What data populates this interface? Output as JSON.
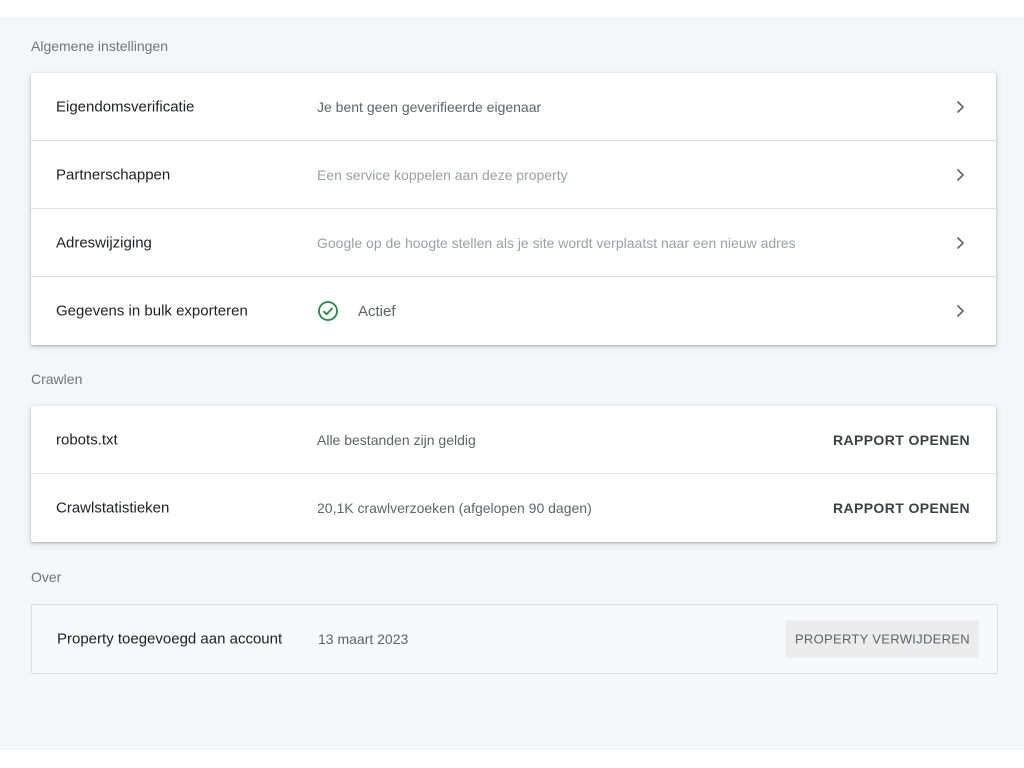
{
  "general": {
    "title": "Algemene instellingen",
    "rows": [
      {
        "label": "Eigendomsverificatie",
        "value": "Je bent geen geverifieerde eigenaar"
      },
      {
        "label": "Partnerschappen",
        "value": "Een service koppelen aan deze property"
      },
      {
        "label": "Adreswijziging",
        "value": "Google op de hoogte stellen als je site wordt verplaatst naar een nieuw adres"
      },
      {
        "label": "Gegevens in bulk exporteren",
        "status": "Actief",
        "status_icon": "check-circle-icon",
        "status_color": "#1e8e3e"
      }
    ]
  },
  "crawl": {
    "title": "Crawlen",
    "rows": [
      {
        "label": "robots.txt",
        "value": "Alle bestanden zijn geldig",
        "action": "RAPPORT OPENEN"
      },
      {
        "label": "Crawlstatistieken",
        "value": "20,1K crawlverzoeken (afgelopen 90 dagen)",
        "action": "RAPPORT OPENEN"
      }
    ]
  },
  "about": {
    "title": "Over",
    "row": {
      "label": "Property toegevoegd aan account",
      "value": "13 maart 2023",
      "action": "PROPERTY VERWIJDEREN"
    }
  }
}
